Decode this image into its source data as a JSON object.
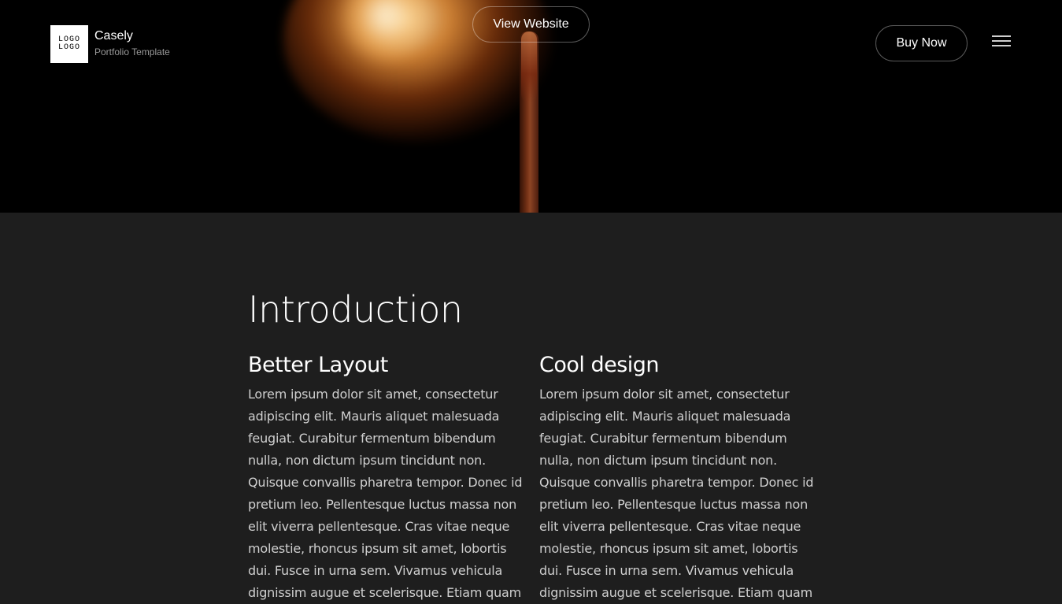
{
  "header": {
    "logo_text": "LOGO LOGO",
    "brand_name": "Casely",
    "brand_subtitle": "Portfolio Template",
    "view_website_label": "View Website",
    "buy_now_label": "Buy Now",
    "menu_icon": "hamburger-menu-icon"
  },
  "hero": {
    "image": "burning-match"
  },
  "intro": {
    "title": "Introduction",
    "columns": [
      {
        "heading": "Better Layout",
        "text": "Lorem ipsum dolor sit amet, consectetur adipiscing elit. Mauris aliquet malesuada feugiat. Curabitur fermentum bibendum nulla, non dictum ipsum tincidunt non. Quisque convallis pharetra tempor. Donec id pretium leo. Pellentesque luctus massa non elit viverra pellentesque. Cras vitae neque molestie, rhoncus ipsum sit amet, lobortis dui. Fusce in urna sem. Vivamus vehicula dignissim augue et scelerisque. Etiam quam"
      },
      {
        "heading": "Cool design",
        "text": "Lorem ipsum dolor sit amet, consectetur adipiscing elit. Mauris aliquet malesuada feugiat. Curabitur fermentum bibendum nulla, non dictum ipsum tincidunt non. Quisque convallis pharetra tempor. Donec id pretium leo. Pellentesque luctus massa non elit viverra pellentesque. Cras vitae neque molestie, rhoncus ipsum sit amet, lobortis dui. Fusce in urna sem. Vivamus vehicula dignissim augue et scelerisque. Etiam quam"
      }
    ]
  },
  "colors": {
    "hero_background": "#000000",
    "page_background": "#1e1e1e",
    "text_primary": "#ffffff",
    "text_body": "#cfcfcf"
  }
}
